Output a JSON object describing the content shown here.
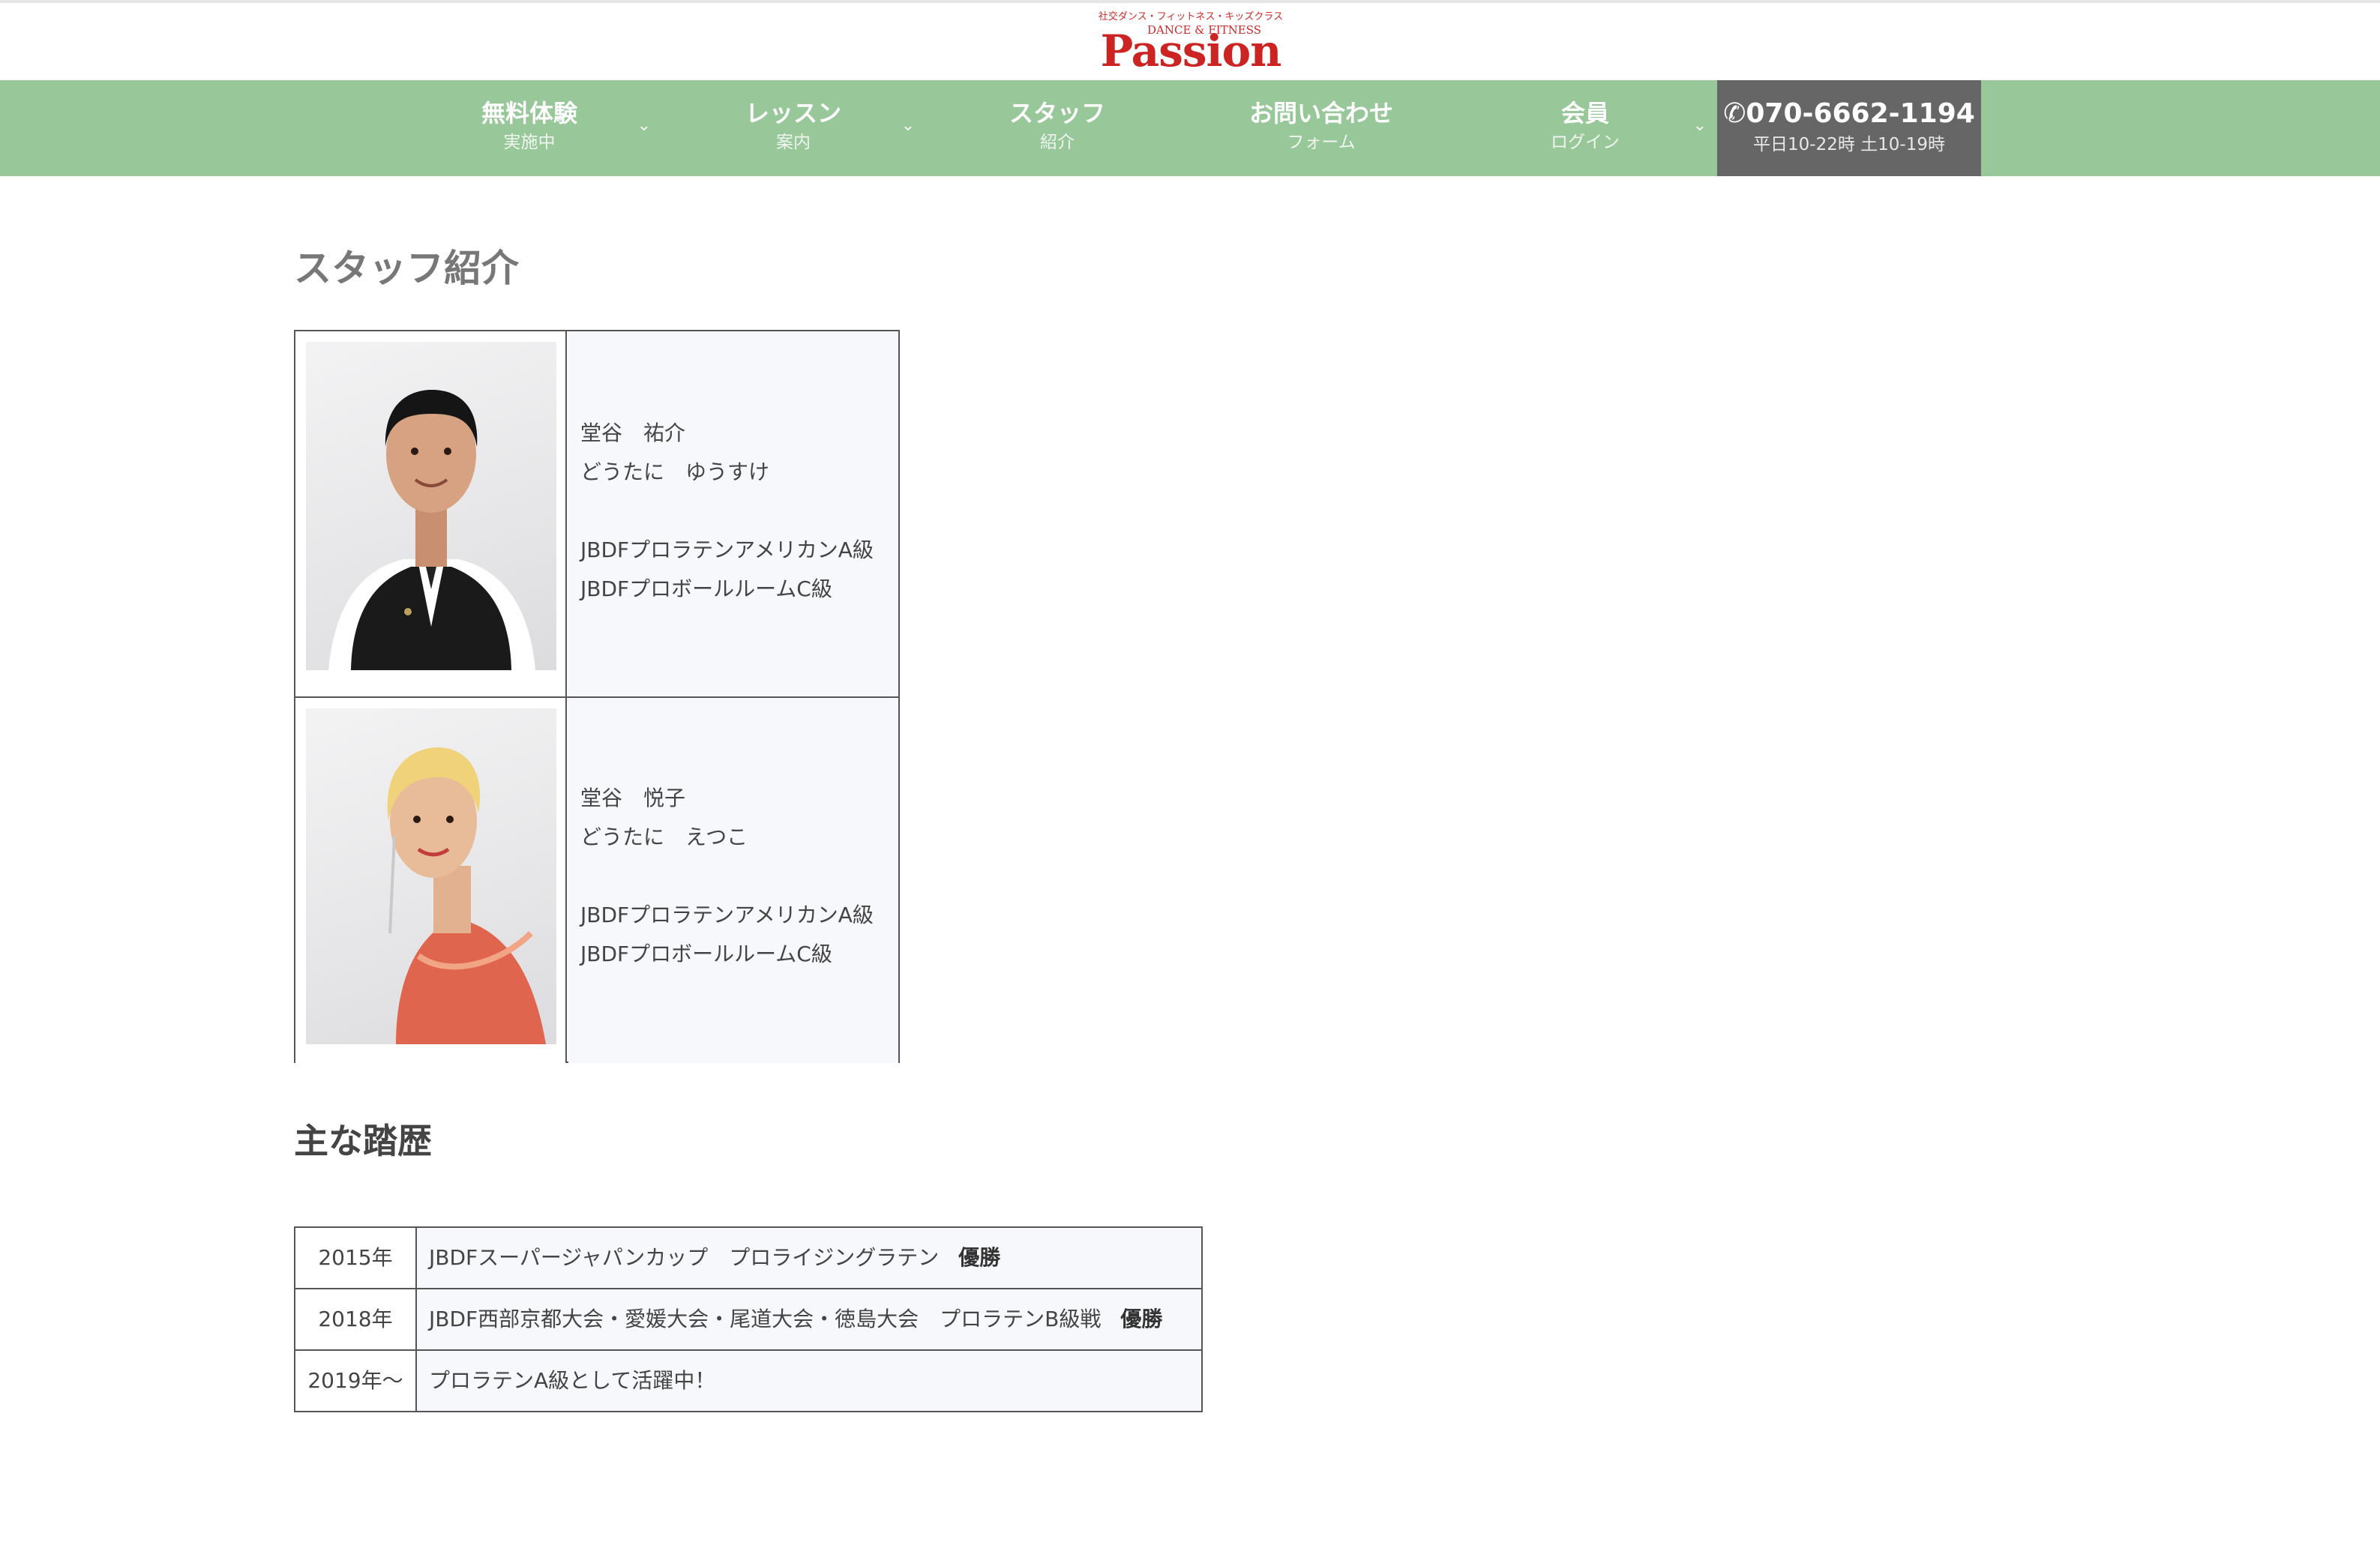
{
  "logo": {
    "tagline": "社交ダンス・フィットネス・キッズクラス",
    "sub": "DANCE & FITNESS",
    "word": "Passion"
  },
  "nav": {
    "items": [
      {
        "main": "無料体験",
        "sub": "実施中",
        "dropdown": true
      },
      {
        "main": "レッスン",
        "sub": "案内",
        "dropdown": true
      },
      {
        "main": "スタッフ",
        "sub": "紹介",
        "dropdown": false
      },
      {
        "main": "お問い合わせ",
        "sub": "フォーム",
        "dropdown": false
      },
      {
        "main": "会員",
        "sub": "ログイン",
        "dropdown": true
      }
    ],
    "phone": {
      "icon": "phone-icon",
      "number": "070-6662-1194",
      "hours": "平日10-22時 土10-19時"
    },
    "colors": {
      "bar": "#98c79a",
      "phone_bg": "#666666"
    }
  },
  "page": {
    "title": "スタッフ紹介"
  },
  "staff": [
    {
      "name": "堂谷　祐介",
      "kana": "どうたに　ゆうすけ",
      "qualifications": [
        "JBDFプロラテンアメリカンA級",
        "JBDFプロボールルームC級"
      ]
    },
    {
      "name": "堂谷　悦子",
      "kana": "どうたに　えつこ",
      "qualifications": [
        "JBDFプロラテンアメリカンA級",
        "JBDFプロボールルームC級"
      ]
    }
  ],
  "history": {
    "title": "主な踏歴",
    "rows": [
      {
        "year": "2015年",
        "event": "JBDFスーパージャパンカップ　プロライジングラテン",
        "result": "優勝"
      },
      {
        "year": "2018年",
        "event": "JBDF西部京都大会・愛媛大会・尾道大会・徳島大会　プロラテンB級戦",
        "result": "優勝"
      },
      {
        "year": "2019年〜",
        "event": "プロラテンA級として活躍中！",
        "result": ""
      }
    ]
  }
}
